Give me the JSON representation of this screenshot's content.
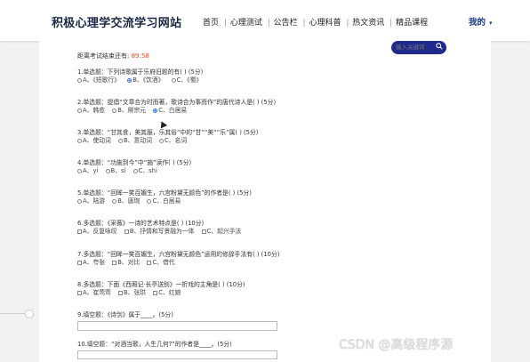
{
  "header": {
    "site_title": "积极心理学交流学习网站",
    "nav": [
      "首页",
      "心理测试",
      "公告栏",
      "心理科普",
      "热文资讯",
      "精品课程"
    ],
    "me_label": "我的"
  },
  "search": {
    "placeholder": "输入关键词"
  },
  "timer": {
    "label": "距离考试结束还有:",
    "value": "89:58"
  },
  "questions": [
    {
      "title": "1.单选题：下列诗歌属于乐府旧题的有( ) (5分)",
      "type": "radio",
      "options": [
        "A、《短歌行》",
        "B、《饮酒》",
        "C、《蜀》"
      ],
      "selected": 1
    },
    {
      "title": "2.单选题：提倡“文章合为时而著，歌诗合为事而作”的唐代诗人是( ) (5分)",
      "type": "radio",
      "options": [
        "A、韩愈",
        "B、柳宗元",
        "C、白居易"
      ],
      "selected": 2
    },
    {
      "title": "3.单选题：“甘其食，美其服，乐其俗”中的“甘”“美”“乐”属( ) (5分)",
      "type": "radio",
      "options": [
        "A、使动词",
        "B、意动词",
        "C、名词"
      ],
      "selected": -1
    },
    {
      "title": "4.单选题：“功施到今”中“施”读作( ) (5分)",
      "type": "radio",
      "options": [
        "A、yi",
        "B、si",
        "C、shi"
      ],
      "selected": -1
    },
    {
      "title": "5.单选题：“回眸一笑百媚生，六宫粉黛无颜色”的作者是( ) (5分)",
      "type": "radio",
      "options": [
        "A、陆游",
        "B、唐琬",
        "C、白居易"
      ],
      "selected": -1
    },
    {
      "title": "6.多选题：《采薇》一诗的艺术特点是( ) (10分)",
      "type": "check",
      "options": [
        "A、反复咏叹",
        "B、抒情和写景融为一体",
        "C、起兴手法"
      ],
      "selected": -1
    },
    {
      "title": "7.多选题：“回眸一笑百媚生，六宫粉黛无颜色”运用的修辞手法有( ) (10分)",
      "type": "check",
      "options": [
        "A、夸张",
        "B、对比",
        "C、借代"
      ],
      "selected": -1
    },
    {
      "title": "8.多选题：下面《西厢记·长亭送别》一折戏的主角是( ) (10分)",
      "type": "check",
      "options": [
        "A、崔莺莺",
        "B、张珙",
        "C、红娘"
      ],
      "selected": -1
    },
    {
      "title": "9.填空题：《诗剑》属于____。(5分)",
      "type": "fill"
    },
    {
      "title": "10.填空题：“对酒当歌，人生几何?”的作者是____。(5分)",
      "type": "fill"
    }
  ],
  "watermark": "CSDN @高级程序源"
}
